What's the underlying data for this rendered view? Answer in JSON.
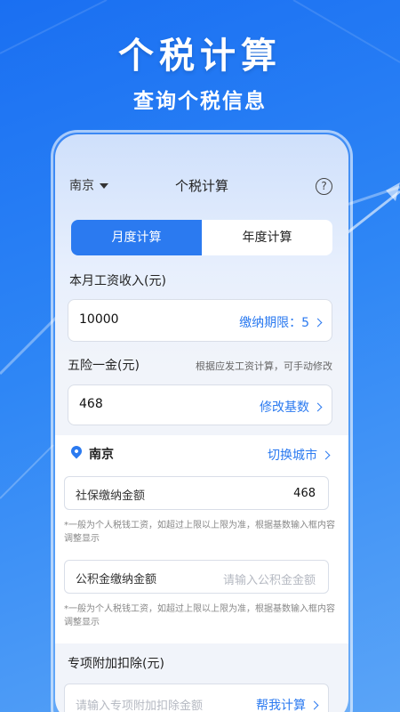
{
  "hero": {
    "title": "个税计算",
    "subtitle": "查询个税信息"
  },
  "navbar": {
    "city": "南京",
    "title": "个税计算",
    "help": "?"
  },
  "tabs": [
    {
      "label": "月度计算",
      "active": true
    },
    {
      "label": "年度计算",
      "active": false
    }
  ],
  "salary": {
    "label": "本月工资收入(元)",
    "value": "10000",
    "period_label": "缴纳期限：5"
  },
  "insurance": {
    "label": "五险一金(元)",
    "hint": "根据应发工资计算，可手动修改",
    "value": "468",
    "action": "修改基数"
  },
  "city_section": {
    "city": "南京",
    "switch_label": "切换城市",
    "social_label": "社保缴纳金额",
    "social_value": "468",
    "social_note": "*一般为个人税钱工资，如超过上限以上限为准，根据基数输入框内容调整显示",
    "fund_label": "公积金缴纳金额",
    "fund_placeholder": "请输入公积金金额",
    "fund_note": "*一般为个人税钱工资，如超过上限以上限为准，根据基数输入框内容调整显示"
  },
  "deduction": {
    "label": "专项附加扣除(元)",
    "placeholder": "请输入专项附加扣除金额",
    "action": "帮我计算"
  },
  "colors": {
    "accent": "#2b7af0",
    "background": "#1a6ff2"
  }
}
